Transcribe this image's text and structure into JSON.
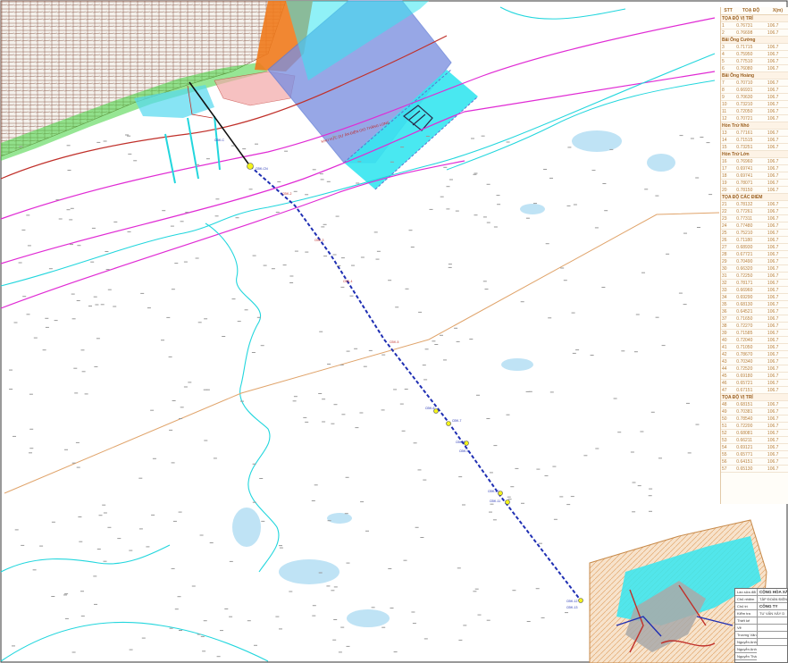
{
  "map": {
    "cable_route_points": [
      "CĐK-CN",
      "CĐK-C",
      "CĐK-2",
      "CĐK-3",
      "CĐK-4",
      "CĐK-5",
      "CĐK-6",
      "CĐK-7",
      "CĐK-8",
      "CĐK-9",
      "CĐK-10",
      "CĐK-11",
      "CĐK-12",
      "CĐK-13"
    ],
    "zone_label": "KHU VỰC DỰ ÁN ĐIỆN GIÓ THĂNG LONG",
    "colors": {
      "sea": "#ffffff",
      "depth_contour": "#22d6dd",
      "shallow_fill": "#bfe3f5",
      "project_zone": "#7b8fe0",
      "project_zone_edge": "#5f7bd6",
      "cyan_block": "#35e6f0",
      "cable_route": "#1f2fb3",
      "boundary_orange": "#e0a46b",
      "magenta_line": "#e02bd4",
      "red_line": "#c0302a",
      "land_orange": "#f07a1c",
      "vegetation": "#3fd13c"
    }
  },
  "coordinate_table": {
    "headers": [
      "STT",
      "TOẠ ĐỘ",
      "X(m)"
    ],
    "groups": [
      {
        "title": "TỌA ĐỘ VỊ TRÍ",
        "rows": [
          [
            "1",
            "0.76731",
            "106.7"
          ],
          [
            "2",
            "0.76698",
            "106.7"
          ]
        ]
      },
      {
        "title": "Bãi Ông Cường",
        "rows": [
          [
            "3",
            "0.71715",
            "106.7"
          ],
          [
            "4",
            "0.75950",
            "106.7"
          ],
          [
            "5",
            "0.77510",
            "106.7"
          ],
          [
            "6",
            "0.76080",
            "106.7"
          ]
        ]
      },
      {
        "title": "Bãi Ông Hoàng",
        "rows": [
          [
            "7",
            "0.70710",
            "106.7"
          ],
          [
            "8",
            "0.66931",
            "106.7"
          ],
          [
            "9",
            "0.70630",
            "106.7"
          ],
          [
            "10",
            "0.73210",
            "106.7"
          ],
          [
            "11",
            "0.72050",
            "106.7"
          ],
          [
            "12",
            "0.70721",
            "106.7"
          ]
        ]
      },
      {
        "title": "Hòn Trứ Nhỏ",
        "rows": [
          [
            "13",
            "0.77161",
            "106.7"
          ],
          [
            "14",
            "0.71515",
            "106.7"
          ],
          [
            "15",
            "0.73251",
            "106.7"
          ]
        ]
      },
      {
        "title": "Hòn Trứ Lớn",
        "rows": [
          [
            "16",
            "0.76960",
            "106.7"
          ],
          [
            "17",
            "0.69741",
            "106.7"
          ],
          [
            "18",
            "0.69741",
            "106.7"
          ],
          [
            "19",
            "0.78071",
            "106.7"
          ],
          [
            "20",
            "0.78150",
            "106.7"
          ]
        ]
      },
      {
        "title": "TỌA ĐỘ CÁC ĐIỂM",
        "rows": [
          [
            "21",
            "0.78132",
            "106.7"
          ],
          [
            "22",
            "0.77261",
            "106.7"
          ],
          [
            "23",
            "0.77311",
            "106.7"
          ],
          [
            "24",
            "0.77480",
            "106.7"
          ],
          [
            "25",
            "0.75210",
            "106.7"
          ],
          [
            "26",
            "0.71180",
            "106.7"
          ],
          [
            "27",
            "0.68930",
            "106.7"
          ],
          [
            "28",
            "0.67721",
            "106.7"
          ],
          [
            "29",
            "0.70490",
            "106.7"
          ],
          [
            "30",
            "0.66320",
            "106.7"
          ],
          [
            "31",
            "0.72250",
            "106.7"
          ],
          [
            "32",
            "0.78171",
            "106.7"
          ],
          [
            "33",
            "0.66960",
            "106.7"
          ],
          [
            "34",
            "0.69290",
            "106.7"
          ],
          [
            "35",
            "0.68130",
            "106.7"
          ],
          [
            "36",
            "0.64521",
            "106.7"
          ],
          [
            "37",
            "0.71650",
            "106.7"
          ],
          [
            "38",
            "0.72270",
            "106.7"
          ],
          [
            "39",
            "0.71585",
            "106.7"
          ],
          [
            "40",
            "0.72040",
            "106.7"
          ],
          [
            "41",
            "0.71050",
            "106.7"
          ],
          [
            "42",
            "0.78670",
            "106.7"
          ],
          [
            "43",
            "0.70340",
            "106.7"
          ],
          [
            "44",
            "0.72520",
            "106.7"
          ],
          [
            "45",
            "0.69180",
            "106.7"
          ],
          [
            "46",
            "0.65721",
            "106.7"
          ],
          [
            "47",
            "0.67151",
            "106.7"
          ]
        ]
      },
      {
        "title": "TỌA ĐỘ VỊ TRÍ",
        "rows": [
          [
            "48",
            "0.68151",
            "106.7"
          ],
          [
            "49",
            "0.70381",
            "106.7"
          ],
          [
            "50",
            "0.78540",
            "106.7"
          ],
          [
            "51",
            "0.72200",
            "106.7"
          ],
          [
            "52",
            "0.68081",
            "106.7"
          ],
          [
            "53",
            "0.66211",
            "106.7"
          ],
          [
            "54",
            "0.69121",
            "106.7"
          ],
          [
            "55",
            "0.65771",
            "106.7"
          ],
          [
            "56",
            "0.64151",
            "106.7"
          ],
          [
            "57",
            "0.65130",
            "106.7"
          ]
        ]
      }
    ]
  },
  "title_block": {
    "left_rows": [
      "Lần sửa đổi",
      "Chủ nhiệm",
      "Chủ trì",
      "Kiểm tra",
      "Thiết kế",
      "Vẽ"
    ],
    "right_rows": [
      "CỘNG HÒA XÃ HỘI CHỦ NGHĨA",
      "TẬP ĐOÀN ĐIỆN LỰC",
      "CÔNG TY",
      "TƯ VẤN XÂY D",
      "",
      "",
      "",
      ""
    ],
    "names": [
      "Trương Văn Hưng",
      "Nguyễn Anh Kiên",
      "Nguyễn Anh Kiên",
      "Nguyễn Thành Nam"
    ]
  }
}
